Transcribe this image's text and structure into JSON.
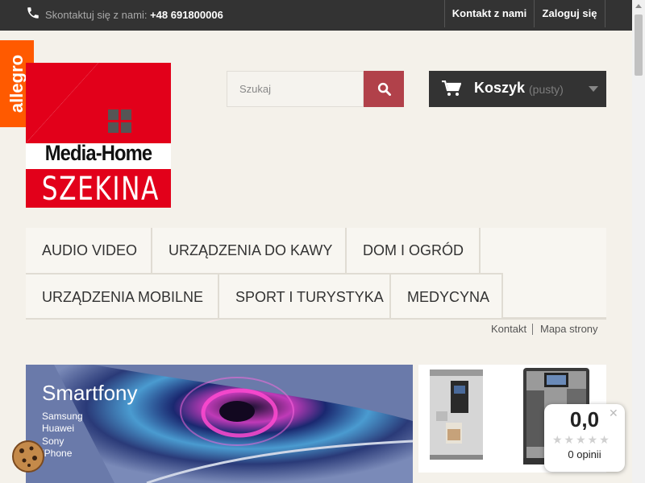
{
  "topbar": {
    "contact_prefix": "Skontaktuj się z nami:",
    "phone": "+48 691800006",
    "contact_link": "Kontakt z nami",
    "login_link": "Zaloguj się"
  },
  "allegro_badge": "allegro",
  "logo": {
    "line1": "Media-Home",
    "line2": "SZEKINA"
  },
  "search": {
    "placeholder": "Szukaj"
  },
  "cart": {
    "label": "Koszyk",
    "status": "(pusty)"
  },
  "menu": {
    "items": [
      "AUDIO VIDEO",
      "URZĄDZENIA DO KAWY",
      "DOM I OGRÓD",
      "URZĄDZENIA MOBILNE",
      "SPORT I TURYSTYKA",
      "MEDYCYNA"
    ]
  },
  "sublinks": {
    "contact": "Kontakt",
    "sitemap": "Mapa strony"
  },
  "banner": {
    "title": "Smartfony",
    "brands": [
      "Samsung",
      "Huawei",
      "Sony",
      "iPhone"
    ]
  },
  "rating_widget": {
    "score": "0,0",
    "reviews": "0 opinii"
  },
  "colors": {
    "topbar": "#333333",
    "search_button": "#b1414a",
    "allegro": "#ff5a00",
    "logo_red": "#e2001a"
  }
}
